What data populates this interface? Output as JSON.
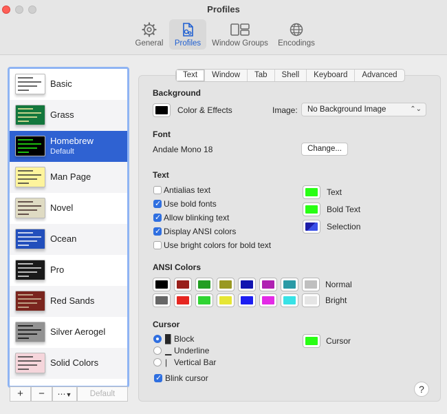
{
  "window": {
    "title": "Profiles"
  },
  "toolbar": {
    "items": [
      {
        "label": "General",
        "icon": "gear-icon"
      },
      {
        "label": "Profiles",
        "icon": "profile-document-icon"
      },
      {
        "label": "Window Groups",
        "icon": "window-groups-icon"
      },
      {
        "label": "Encodings",
        "icon": "globe-icon"
      }
    ],
    "active": "Profiles"
  },
  "profiles": [
    {
      "name": "Basic",
      "bg": "#ffffff",
      "fg": "#333333"
    },
    {
      "name": "Grass",
      "bg": "#13773d",
      "fg": "#fff0a5"
    },
    {
      "name": "Homebrew",
      "subtitle": "Default",
      "bg": "#000000",
      "fg": "#28fe14",
      "selected": true
    },
    {
      "name": "Man Page",
      "bg": "#fef49c",
      "fg": "#333333"
    },
    {
      "name": "Novel",
      "bg": "#dfdbc3",
      "fg": "#3b2322"
    },
    {
      "name": "Ocean",
      "bg": "#224fbc",
      "fg": "#ffffff"
    },
    {
      "name": "Pro",
      "bg": "#1a1a1a",
      "fg": "#f2f2f2"
    },
    {
      "name": "Red Sands",
      "bg": "#7a251e",
      "fg": "#d7c9a7"
    },
    {
      "name": "Silver Aerogel",
      "bg": "#929292",
      "fg": "#000000"
    },
    {
      "name": "Solid Colors",
      "bg": "#f5d5db",
      "fg": "#333333"
    }
  ],
  "list_buttons": {
    "add": "+",
    "remove": "−",
    "more": "⋯",
    "default": "Default"
  },
  "tabs": [
    "Text",
    "Window",
    "Tab",
    "Shell",
    "Keyboard",
    "Advanced"
  ],
  "active_tab": "Text",
  "background": {
    "heading": "Background",
    "color_effects_label": "Color & Effects",
    "color": "#000000",
    "image_label": "Image:",
    "image_value": "No Background Image"
  },
  "font": {
    "heading": "Font",
    "value": "Andale Mono 18",
    "change_button": "Change..."
  },
  "text": {
    "heading": "Text",
    "options": [
      {
        "label": "Antialias text",
        "checked": false
      },
      {
        "label": "Use bold fonts",
        "checked": true
      },
      {
        "label": "Allow blinking text",
        "checked": true
      },
      {
        "label": "Display ANSI colors",
        "checked": true
      },
      {
        "label": "Use bright colors for bold text",
        "checked": false
      }
    ],
    "colors": [
      {
        "label": "Text",
        "color": "#28fe14"
      },
      {
        "label": "Bold Text",
        "color": "#28fe14"
      },
      {
        "label": "Selection",
        "color": "#1d1da8"
      }
    ]
  },
  "ansi": {
    "heading": "ANSI Colors",
    "normal_label": "Normal",
    "bright_label": "Bright",
    "normal": [
      "#000000",
      "#991f1a",
      "#239e23",
      "#999822",
      "#1114b0",
      "#b021b2",
      "#2a9aa6",
      "#bfbfbf"
    ],
    "bright": [
      "#666666",
      "#e62620",
      "#30d433",
      "#e6e634",
      "#1c1ef2",
      "#e32ae6",
      "#38e2e6",
      "#e5e5e5"
    ]
  },
  "cursor": {
    "heading": "Cursor",
    "options": [
      {
        "glyph": "█",
        "label": "Block",
        "selected": true
      },
      {
        "glyph": "▁",
        "label": "Underline",
        "selected": false
      },
      {
        "glyph": "|",
        "label": "Vertical Bar",
        "selected": false
      }
    ],
    "blink_label": "Blink cursor",
    "blink_checked": true,
    "color_label": "Cursor",
    "color": "#28fe14"
  },
  "help": "?"
}
